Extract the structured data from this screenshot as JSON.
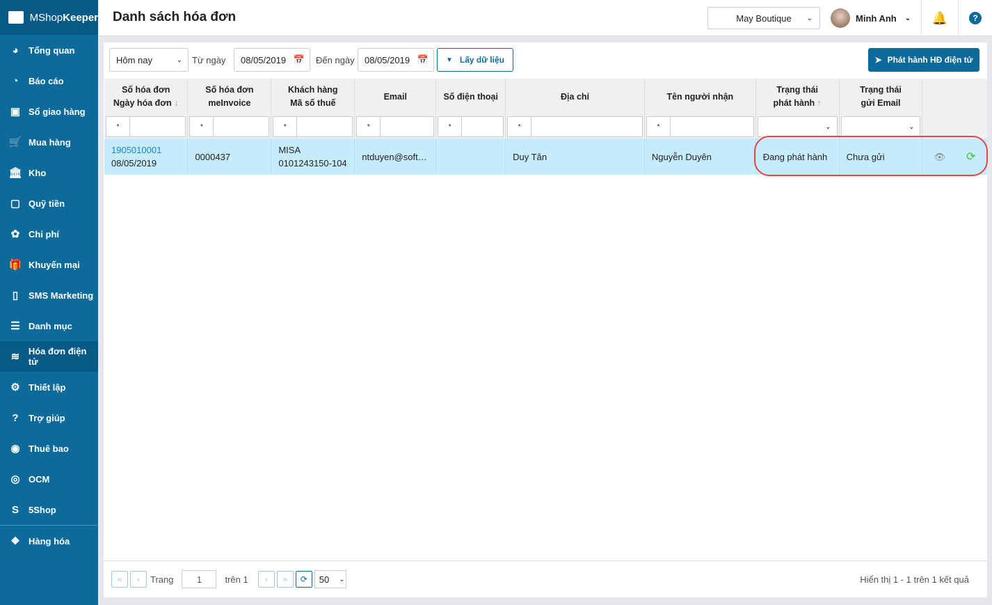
{
  "app": {
    "brand_light": "MShop",
    "brand_bold": "Keeper"
  },
  "sidebar": {
    "items": [
      {
        "label": "Tổng quan",
        "icon": "dashboard-icon"
      },
      {
        "label": "Báo cáo",
        "icon": "pie-chart-icon"
      },
      {
        "label": "Sổ giao hàng",
        "icon": "delivery-icon"
      },
      {
        "label": "Mua hàng",
        "icon": "cart-icon"
      },
      {
        "label": "Kho",
        "icon": "warehouse-icon"
      },
      {
        "label": "Quỹ tiền",
        "icon": "safe-icon"
      },
      {
        "label": "Chi phí",
        "icon": "money-icon"
      },
      {
        "label": "Khuyến mại",
        "icon": "gift-icon"
      },
      {
        "label": "SMS Marketing",
        "icon": "phone-icon"
      },
      {
        "label": "Danh mục",
        "icon": "list-icon"
      },
      {
        "label": "Hóa đơn điện tử",
        "icon": "invoice-icon",
        "active": true
      },
      {
        "label": "Thiết lập",
        "icon": "gear-icon"
      },
      {
        "label": "Trợ giúp",
        "icon": "help-icon"
      },
      {
        "label": "Thuê bao",
        "icon": "user-icon"
      },
      {
        "label": "OCM",
        "icon": "ocm-icon"
      },
      {
        "label": "5Shop",
        "icon": "5shop-icon"
      },
      {
        "label": "Hàng hóa",
        "icon": "boxes-icon"
      }
    ]
  },
  "header": {
    "title": "Danh sách hóa đơn",
    "store": "May Boutique",
    "user": "Minh Anh"
  },
  "toolbar": {
    "period": "Hôm nay",
    "from_label": "Từ ngày",
    "from": "08/05/2019",
    "to_label": "Đến ngày",
    "to": "08/05/2019",
    "fetch": "Lấy dữ liệu",
    "issue": "Phát hành HĐ điện tử"
  },
  "table": {
    "columns": [
      {
        "l1": "Số hóa đơn",
        "l2": "Ngày hóa đơn"
      },
      {
        "l1": "Số hóa đơn",
        "l2": "meInvoice"
      },
      {
        "l1": "Khách hàng",
        "l2": "Mã số thuế"
      },
      {
        "l1": "Email",
        "l2": ""
      },
      {
        "l1": "Số điện thoại",
        "l2": ""
      },
      {
        "l1": "Địa chỉ",
        "l2": ""
      },
      {
        "l1": "Tên người nhận",
        "l2": ""
      },
      {
        "l1": "Trạng thái",
        "l2": "phát hành"
      },
      {
        "l1": "Trạng thái",
        "l2": "gửi Email"
      }
    ],
    "filter_op": "*",
    "rows": [
      {
        "invoice_no": "1905010001",
        "date": "08/05/2019",
        "meinvoice": "0000437",
        "customer": "MISA",
        "tax": "0101243150-104",
        "email": "ntduyen@soft…",
        "phone": "",
        "address": "Duy Tân",
        "recipient": "Nguyễn Duyên",
        "issue_status": "Đang phát hành",
        "email_status": "Chưa gửi"
      }
    ]
  },
  "pager": {
    "page_label": "Trang",
    "page": "1",
    "of": "trên 1",
    "size": "50",
    "summary": "Hiển thị 1 - 1 trên 1 kết quả"
  }
}
